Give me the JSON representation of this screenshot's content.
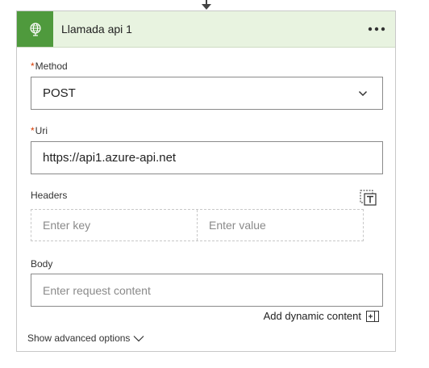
{
  "action": {
    "title": "Llamada api 1",
    "icon": "globe-icon",
    "menu_icon": "ellipsis-icon",
    "accent_color": "#4f9a3d",
    "header_bg": "#e8f3e0"
  },
  "method": {
    "required_marker": "*",
    "label": "Method",
    "value": "POST"
  },
  "uri": {
    "required_marker": "*",
    "label": "Uri",
    "value": "https://api1.azure-api.net"
  },
  "headers": {
    "label": "Headers",
    "key_placeholder": "Enter key",
    "value_placeholder": "Enter value",
    "switch_icon": "text-mode-icon"
  },
  "body": {
    "label": "Body",
    "placeholder": "Enter request content"
  },
  "dynamic_content": {
    "label": "Add dynamic content"
  },
  "advanced": {
    "label": "Show advanced options"
  }
}
